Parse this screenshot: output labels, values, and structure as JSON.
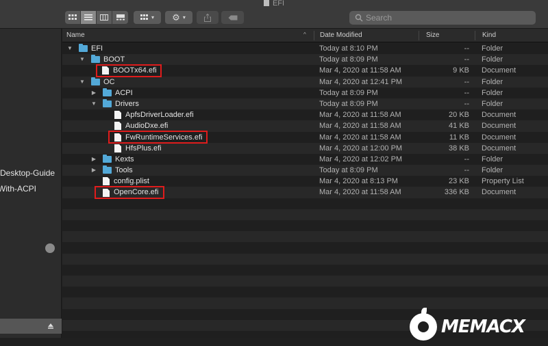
{
  "window": {
    "title": "EFI"
  },
  "search": {
    "placeholder": "Search"
  },
  "sidebar": {
    "items": [
      {
        "label": "Desktop-Guide"
      },
      {
        "label": "With-ACPI"
      }
    ]
  },
  "columns": {
    "name": "Name",
    "date": "Date Modified",
    "size": "Size",
    "kind": "Kind"
  },
  "rows": [
    {
      "name": "EFI",
      "type": "folder",
      "disclosure": "expanded",
      "date": "Today at 8:10 PM",
      "size": "--",
      "kind": "Folder"
    },
    {
      "name": "BOOT",
      "type": "folder",
      "disclosure": "expanded",
      "date": "Today at 8:09 PM",
      "size": "--",
      "kind": "Folder"
    },
    {
      "name": "BOOTx64.efi",
      "type": "file",
      "date": "Mar 4, 2020 at 11:58 AM",
      "size": "9 KB",
      "kind": "Document"
    },
    {
      "name": "OC",
      "type": "folder",
      "disclosure": "expanded",
      "date": "Mar 4, 2020 at 12:41 PM",
      "size": "--",
      "kind": "Folder"
    },
    {
      "name": "ACPI",
      "type": "folder",
      "disclosure": "collapsed",
      "date": "Today at 8:09 PM",
      "size": "--",
      "kind": "Folder"
    },
    {
      "name": "Drivers",
      "type": "folder",
      "disclosure": "expanded",
      "date": "Today at 8:09 PM",
      "size": "--",
      "kind": "Folder"
    },
    {
      "name": "ApfsDriverLoader.efi",
      "type": "file",
      "date": "Mar 4, 2020 at 11:58 AM",
      "size": "20 KB",
      "kind": "Document"
    },
    {
      "name": "AudioDxe.efi",
      "type": "file",
      "date": "Mar 4, 2020 at 11:58 AM",
      "size": "41 KB",
      "kind": "Document"
    },
    {
      "name": "FwRuntimeServices.efi",
      "type": "file",
      "date": "Mar 4, 2020 at 11:58 AM",
      "size": "11 KB",
      "kind": "Document"
    },
    {
      "name": "HfsPlus.efi",
      "type": "file",
      "date": "Mar 4, 2020 at 12:00 PM",
      "size": "38 KB",
      "kind": "Document"
    },
    {
      "name": "Kexts",
      "type": "folder",
      "disclosure": "collapsed",
      "date": "Mar 4, 2020 at 12:02 PM",
      "size": "--",
      "kind": "Folder"
    },
    {
      "name": "Tools",
      "type": "folder",
      "disclosure": "collapsed",
      "date": "Today at 8:09 PM",
      "size": "--",
      "kind": "Folder"
    },
    {
      "name": "config.plist",
      "type": "file",
      "date": "Mar 4, 2020 at 8:13 PM",
      "size": "23 KB",
      "kind": "Property List"
    },
    {
      "name": "OpenCore.efi",
      "type": "file",
      "date": "Mar 4, 2020 at 11:58 AM",
      "size": "336 KB",
      "kind": "Document"
    }
  ],
  "logo": {
    "text": "MEMACX"
  },
  "colors": {
    "highlight": "#e01c1c",
    "folder": "#53a9d8"
  }
}
